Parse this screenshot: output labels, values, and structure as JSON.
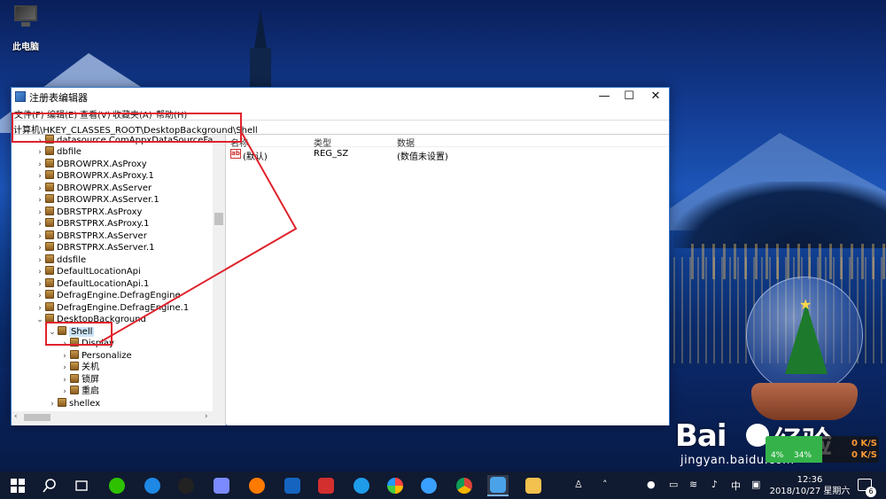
{
  "desktop": {
    "icons": [
      {
        "label": "此电脑",
        "icon": "computer-icon"
      }
    ]
  },
  "window": {
    "title": "注册表编辑器",
    "controls": {
      "minimize": "—",
      "maximize": "☐",
      "close": "✕"
    },
    "menu": [
      "文件(F)",
      "编辑(E)",
      "查看(V)",
      "收藏夹(A)",
      "帮助(H)"
    ],
    "address": "计算机\\HKEY_CLASSES_ROOT\\DesktopBackground\\Shell"
  },
  "tree": {
    "items": [
      {
        "label": "datasource.ComAppxDataSourceFacto",
        "expanded": false
      },
      {
        "label": "dbfile",
        "expanded": false
      },
      {
        "label": "DBROWPRX.AsProxy",
        "expanded": false
      },
      {
        "label": "DBROWPRX.AsProxy.1",
        "expanded": false
      },
      {
        "label": "DBROWPRX.AsServer",
        "expanded": false
      },
      {
        "label": "DBROWPRX.AsServer.1",
        "expanded": false
      },
      {
        "label": "DBRSTPRX.AsProxy",
        "expanded": false
      },
      {
        "label": "DBRSTPRX.AsProxy.1",
        "expanded": false
      },
      {
        "label": "DBRSTPRX.AsServer",
        "expanded": false
      },
      {
        "label": "DBRSTPRX.AsServer.1",
        "expanded": false
      },
      {
        "label": "ddsfile",
        "expanded": false
      },
      {
        "label": "DefaultLocationApi",
        "expanded": false
      },
      {
        "label": "DefaultLocationApi.1",
        "expanded": false
      },
      {
        "label": "DefragEngine.DefragEngine",
        "expanded": false
      },
      {
        "label": "DefragEngine.DefragEngine.1",
        "expanded": false
      },
      {
        "label": "DesktopBackground",
        "expanded": true
      },
      {
        "label": "Shell",
        "expanded": true,
        "selected": true
      },
      {
        "label": "Display",
        "expanded": false
      },
      {
        "label": "Personalize",
        "expanded": false
      },
      {
        "label": "关机",
        "expanded": false
      },
      {
        "label": "锁屏",
        "expanded": false
      },
      {
        "label": "重启",
        "expanded": false
      },
      {
        "label": "shellex",
        "expanded": false
      }
    ]
  },
  "list": {
    "columns": [
      "名称",
      "类型",
      "数据"
    ],
    "rows": [
      {
        "name": "(默认)",
        "type": "REG_SZ",
        "data": "(数值未设置)"
      }
    ]
  },
  "watermark": {
    "logo": "Bai",
    "logo2": "经验",
    "url": "jingyan.baidu.com"
  },
  "netspeed": {
    "cpu": "4%",
    "mem": "34%",
    "up": "0 K/S",
    "down": "0 K/S"
  },
  "taskbar": {
    "tray": {
      "ime": "中",
      "time": "12:36",
      "date": "2018/10/27 星期六",
      "notifications": "6"
    },
    "colors": {
      "active_underline": "#7ab3ff",
      "annotation": "#e0222c"
    }
  }
}
